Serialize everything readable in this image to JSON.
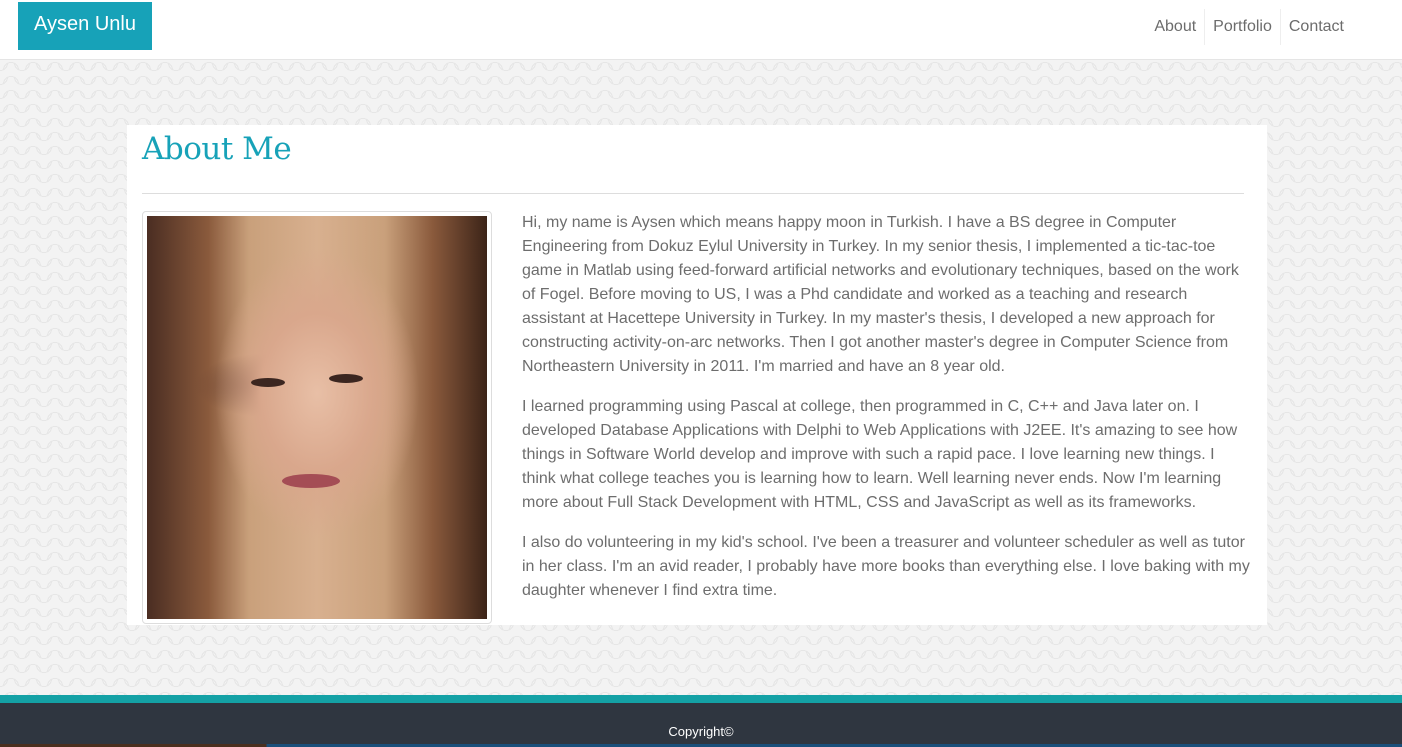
{
  "navbar": {
    "brand": "Aysen Unlu",
    "links": [
      "About",
      "Portfolio",
      "Contact"
    ]
  },
  "about": {
    "title": "About Me",
    "photo_alt": "Portrait of Aysen Unlu",
    "paragraphs": [
      "Hi, my name is Aysen which means happy moon in Turkish. I have a BS degree in Computer Engineering from Dokuz Eylul University in Turkey. In my senior thesis, I implemented a tic-tac-toe game in Matlab using feed-forward artificial networks and evolutionary techniques, based on the work of Fogel. Before moving to US, I was a Phd candidate and worked as a teaching and research assistant at Hacettepe University in Turkey. In my master's thesis, I developed a new approach for constructing activity-on-arc networks. Then I got another master's degree in Computer Science from Northeastern University in 2011. I'm married and have an 8 year old.",
      "I learned programming using Pascal at college, then programmed in C, C++ and Java later on. I developed Database Applications with Delphi to Web Applications with J2EE. It's amazing to see how things in Software World develop and improve with such a rapid pace. I love learning new things. I think what college teaches you is learning how to learn. Well learning never ends. Now I'm learning more about Full Stack Development with HTML, CSS and JavaScript as well as its frameworks.",
      "I also do volunteering in my kid's school. I've been a treasurer and volunteer scheduler as well as tutor in her class. I'm an avid reader, I probably have more books than everything else. I love baking with my daughter whenever I find extra time."
    ]
  },
  "footer": {
    "copyright": "Copyright©"
  },
  "colors": {
    "accent": "#17a2b8",
    "footer_bar": "#14a1a5",
    "footer_bg": "#2f3640"
  }
}
